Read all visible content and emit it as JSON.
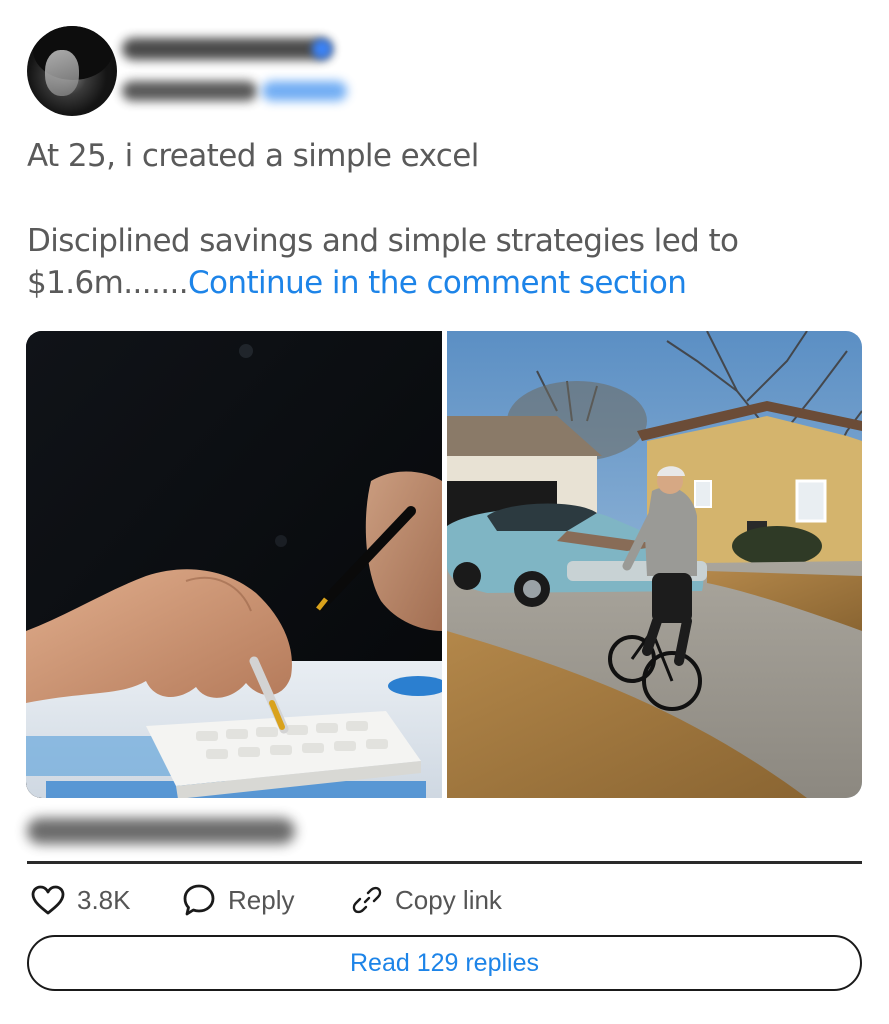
{
  "post": {
    "line1": "At 25, i created a simple excel",
    "line2_text": "Disciplined savings and simple strategies led to $1.6m.......",
    "line2_link": "Continue in the comment section"
  },
  "images": [
    {
      "alt": "hands using calculator with pen"
    },
    {
      "alt": "man riding bicycle near vintage car"
    }
  ],
  "actions": {
    "likes": "3.8K",
    "reply": "Reply",
    "copy_link": "Copy link"
  },
  "read_replies": "Read 129 replies",
  "colors": {
    "accent": "#1d84e8",
    "text": "#5a5a5a"
  }
}
